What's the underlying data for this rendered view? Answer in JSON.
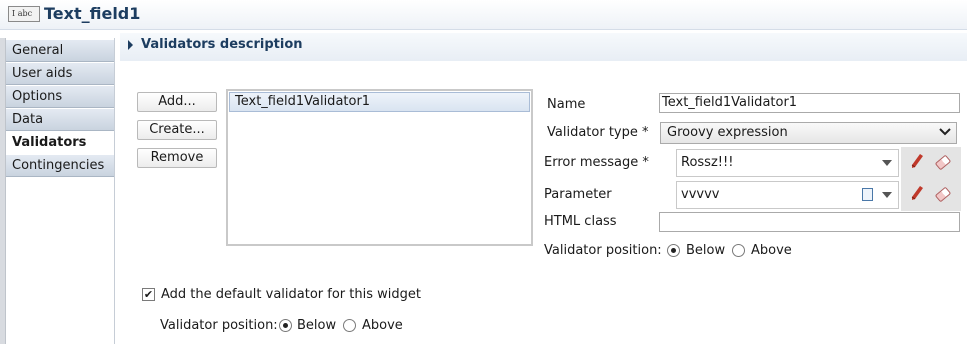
{
  "window": {
    "icon_text": "I abc",
    "title": "Text_field1"
  },
  "nav": {
    "tabs": [
      {
        "label": "General",
        "active": false
      },
      {
        "label": "User aids",
        "active": false
      },
      {
        "label": "Options",
        "active": false
      },
      {
        "label": "Data",
        "active": false
      },
      {
        "label": "Validators",
        "active": true
      },
      {
        "label": "Contingencies",
        "active": false
      }
    ]
  },
  "section": {
    "title": "Validators description"
  },
  "buttons": {
    "add": "Add...",
    "create": "Create...",
    "remove": "Remove"
  },
  "validator_list": {
    "items": [
      "Text_field1Validator1"
    ],
    "selected_index": 0
  },
  "form": {
    "name_label": "Name",
    "name_value": "Text_field1Validator1",
    "type_label": "Validator type *",
    "type_value": "Groovy expression",
    "error_label": "Error message *",
    "error_value": "Rossz!!!",
    "param_label": "Parameter",
    "param_value": "vvvvv",
    "html_class_label": "HTML class",
    "html_class_value": "",
    "position_label": "Validator position:",
    "position_options": [
      "Below",
      "Above"
    ],
    "position_selected": "Below"
  },
  "default_validator": {
    "checkbox_label": "Add the default validator for this widget",
    "checked": true,
    "position_label": "Validator position:",
    "position_options": [
      "Below",
      "Above"
    ],
    "position_selected": "Below"
  },
  "colors": {
    "title": "#1d3d60",
    "edit_icon": "#c0392b"
  }
}
